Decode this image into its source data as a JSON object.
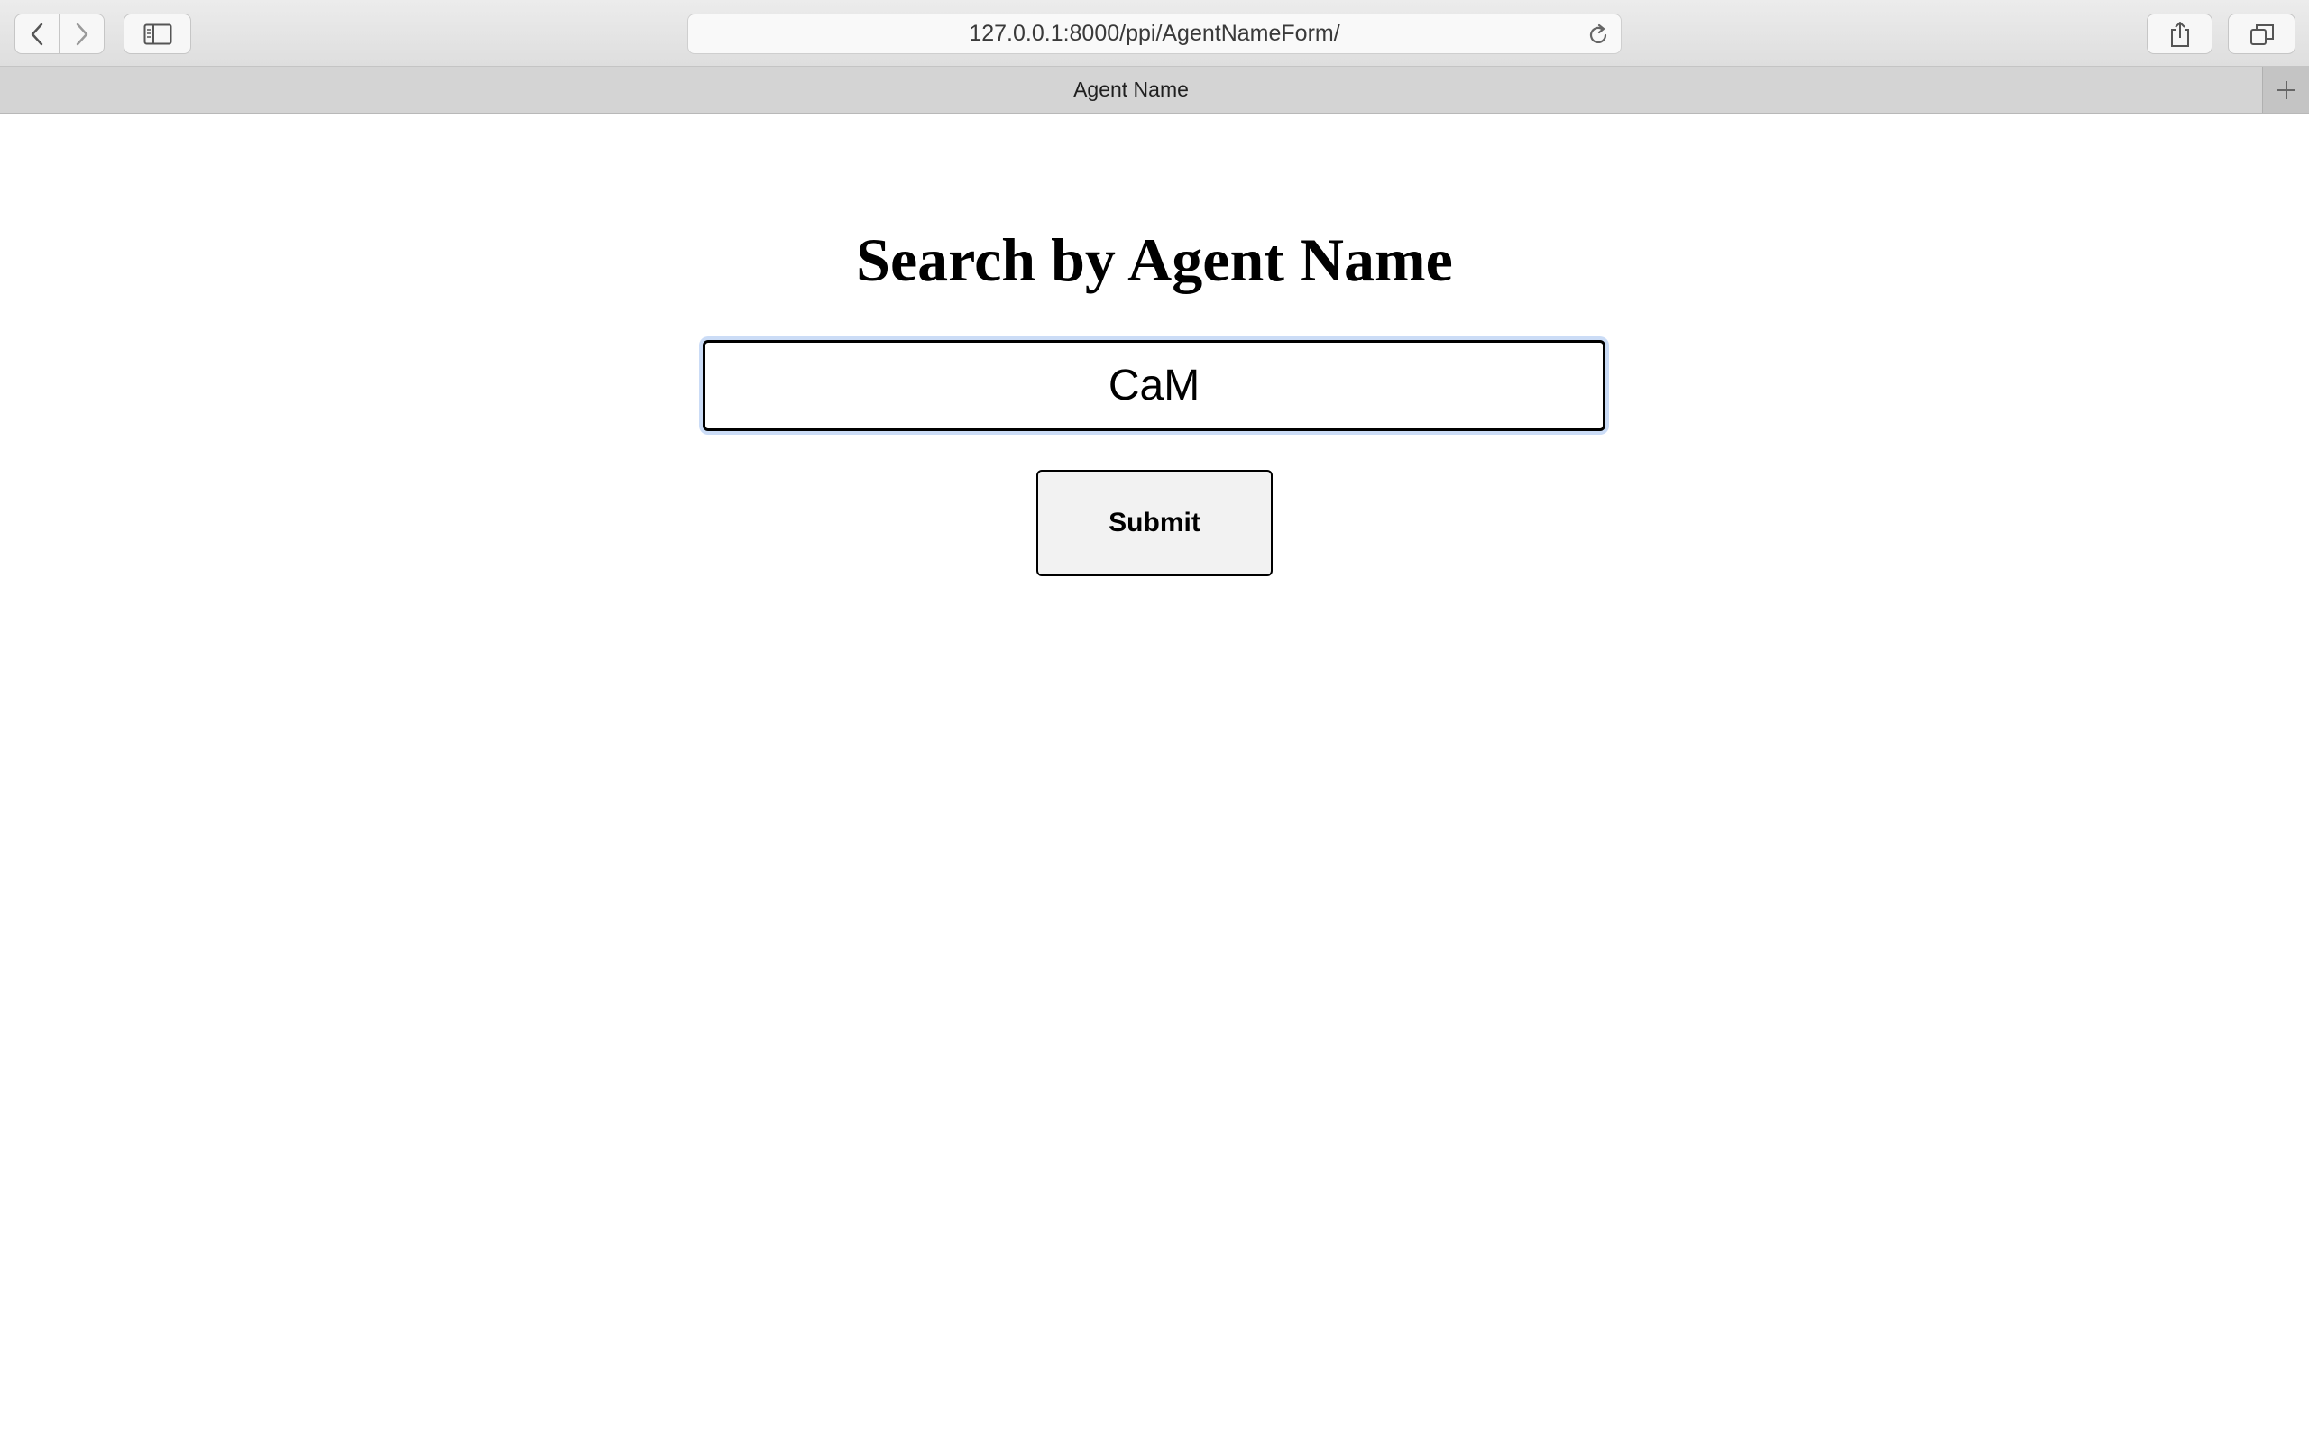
{
  "browser": {
    "url": "127.0.0.1:8000/ppi/AgentNameForm/",
    "tab_title": "Agent Name",
    "icons": {
      "back": "chevron-left-icon",
      "forward": "chevron-right-icon",
      "sidebar": "sidebar-icon",
      "reload": "reload-icon",
      "share": "share-icon",
      "tabs": "tabs-overview-icon",
      "new_tab": "plus-icon"
    }
  },
  "page": {
    "title": "Search by Agent Name",
    "search_input": {
      "value": "CaM"
    },
    "submit_label": "Submit"
  }
}
